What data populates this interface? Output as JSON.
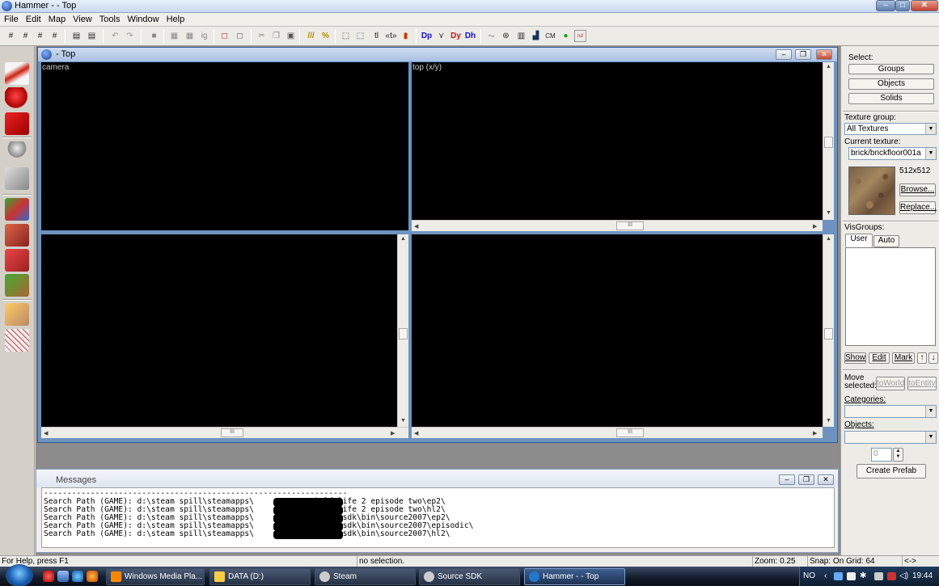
{
  "window": {
    "title": "Hammer - - Top"
  },
  "menu": [
    "File",
    "Edit",
    "Map",
    "View",
    "Tools",
    "Window",
    "Help"
  ],
  "toolbar": {
    "cm_label": "CM"
  },
  "child_window": {
    "title": "- Top",
    "views": {
      "camera_label": "camera",
      "top_label": "top (x/y)"
    }
  },
  "messages": {
    "title": "Messages",
    "separator": "-----------------------------------------------------------------",
    "lines": [
      "Search Path (GAME): d:\\steam spill\\steamapps\\            \\half-life 2 episode two\\ep2\\",
      "Search Path (GAME): d:\\steam spill\\steamapps\\            \\half-life 2 episode two\\hl2\\",
      "Search Path (GAME): d:\\steam spill\\steamapps\\            \\sourcesdk\\bin\\source2007\\ep2\\",
      "Search Path (GAME): d:\\steam spill\\steamapps\\            \\sourcesdk\\bin\\source2007\\episodic\\",
      "Search Path (GAME): d:\\steam spill\\steamapps\\            \\sourcesdk\\bin\\source2007\\hl2\\"
    ]
  },
  "right_panel": {
    "select_label": "Select:",
    "groups_btn": "Groups",
    "objects_btn": "Objects",
    "solids_btn": "Solids",
    "texture_group_label": "Texture group:",
    "texture_group_value": "All Textures",
    "current_texture_label": "Current texture:",
    "current_texture_value": "brick/brickfloor001a",
    "texture_size": "512x512",
    "browse_btn": "Browse...",
    "replace_btn": "Replace...",
    "visgroups_label": "VisGroups:",
    "tab_user": "User",
    "tab_auto": "Auto",
    "show_btn": "Show",
    "edit_btn": "Edit",
    "mark_btn": "Mark",
    "up_btn": "↑",
    "down_btn": "↓",
    "move_selected_label": "Move selected:",
    "toworld_btn": "toWorld",
    "toentity_btn": "toEntity",
    "categories_label": "Categories:",
    "objects_label": "Objects:",
    "count_value": "0",
    "create_prefab_btn": "Create Prefab"
  },
  "status": {
    "help": "For Help, press F1",
    "selection": "no selection.",
    "zoom": "Zoom: 0.25",
    "snap": "Snap: On Grid: 64",
    "arrows": "<->"
  },
  "taskbar": {
    "tasks": [
      "Windows Media Pla...",
      "DATA (D:)",
      "Steam",
      "Source SDK",
      "Hammer - - Top"
    ],
    "lang": "NO",
    "clock": "19:44"
  },
  "colors": {
    "viewport": "#000000",
    "mdi_frame": "#6e93c0",
    "mdi_bg": "#8c8c8c"
  }
}
